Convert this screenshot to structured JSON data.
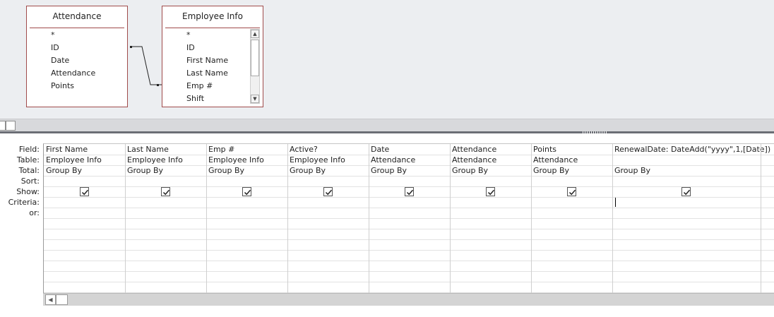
{
  "tables": [
    {
      "title": "Attendance",
      "fields": [
        "*",
        "ID",
        "Date",
        "Attendance",
        "Points"
      ]
    },
    {
      "title": "Employee Info",
      "fields": [
        "*",
        "ID",
        "First Name",
        "Last Name",
        "Emp #",
        "Shift"
      ]
    }
  ],
  "grid": {
    "row_labels": [
      "Field:",
      "Table:",
      "Total:",
      "Sort:",
      "Show:",
      "Criteria:",
      "or:"
    ],
    "columns": [
      {
        "field": "First Name",
        "table": "Employee Info",
        "total": "Group By",
        "sort": "",
        "show": true
      },
      {
        "field": "Last Name",
        "table": "Employee Info",
        "total": "Group By",
        "sort": "",
        "show": true
      },
      {
        "field": "Emp #",
        "table": "Employee Info",
        "total": "Group By",
        "sort": "",
        "show": true
      },
      {
        "field": "Active?",
        "table": "Employee Info",
        "total": "Group By",
        "sort": "",
        "show": true
      },
      {
        "field": "Date",
        "table": "Attendance",
        "total": "Group By",
        "sort": "",
        "show": true
      },
      {
        "field": "Attendance",
        "table": "Attendance",
        "total": "Group By",
        "sort": "",
        "show": true
      },
      {
        "field": "Points",
        "table": "Attendance",
        "total": "Group By",
        "sort": "",
        "show": true
      },
      {
        "field": "RenewalDate: DateAdd(\"yyyy\",1,[Date])",
        "table": "",
        "total": "Group By",
        "sort": "",
        "show": true
      }
    ]
  },
  "icons": {
    "checkbox": "checkmark-icon",
    "scroll_up": "scroll-up-arrow-icon",
    "scroll_down": "scroll-down-arrow-icon",
    "scroll_left": "scroll-left-arrow-icon"
  },
  "colors": {
    "table_border": "#a04b4b",
    "top_pane_bg": "#eceef1"
  }
}
